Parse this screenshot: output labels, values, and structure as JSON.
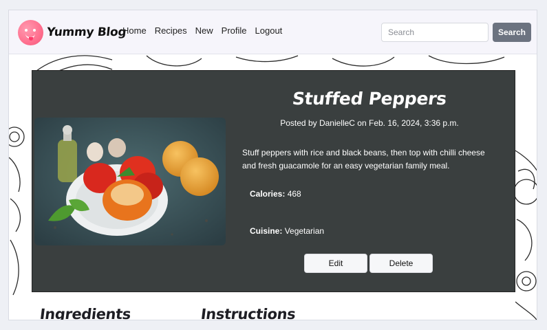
{
  "brand": {
    "name": "Yummy Blog",
    "logo_icon": "smiling-face-tongue-icon",
    "logo_color": "#ff6f8e"
  },
  "nav": {
    "items": [
      "Home",
      "Recipes",
      "New",
      "Profile",
      "Logout"
    ]
  },
  "search": {
    "placeholder": "Search",
    "value": "",
    "button_label": "Search"
  },
  "recipe": {
    "title": "Stuffed Peppers",
    "posted": "Posted by DanielleC on Feb. 16, 2024, 3:36 p.m.",
    "description": "Stuff peppers with rice and black beans, then top with chilli cheese and fresh guacamole for an easy vegetarian family meal.",
    "calories_label": "Calories:",
    "calories_value": "468",
    "cuisine_label": "Cuisine:",
    "cuisine_value": "Vegetarian",
    "edit_label": "Edit",
    "delete_label": "Delete"
  },
  "sections": {
    "ingredients": "Ingredients",
    "instructions": "Instructions"
  },
  "colors": {
    "card_bg": "#3a3f3f",
    "search_button": "#6c7380",
    "navbar_bg": "#f6f5fb"
  }
}
